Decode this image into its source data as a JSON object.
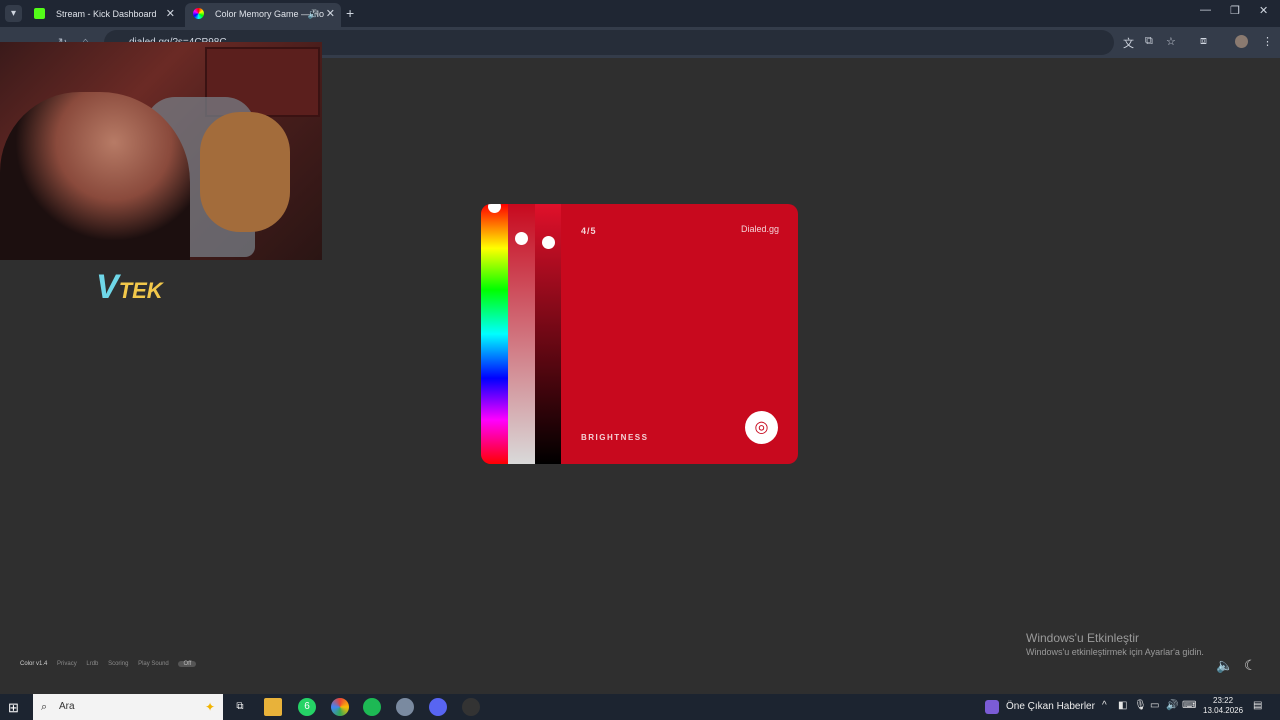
{
  "browser": {
    "tabs": [
      {
        "title": "Stream - Kick Dashboard",
        "favicon_color": "#53fc18"
      },
      {
        "title": "Color Memory Game — Ho",
        "favicon_color": "#e84393"
      }
    ],
    "url": "dialed.gg/?s=4CP98C"
  },
  "overlay": {
    "logo_v": "V",
    "logo_text": "TEK"
  },
  "game": {
    "round": "4/5",
    "brand": "Dialed.gg",
    "slider_label": "BRIGHTNESS",
    "color": "#c8091e"
  },
  "footer": {
    "version": "Color v1.4",
    "privacy": "Privacy",
    "link": "Lrdb",
    "scoring": "Scoring",
    "sound": "Play Sound",
    "sound_state": "Off"
  },
  "watermark": {
    "title": "Windows'u Etkinleştir",
    "subtitle": "Windows'u etkinleştirmek için Ayarlar'a gidin."
  },
  "taskbar": {
    "search_placeholder": "Ara",
    "whatsapp_badge": "6",
    "news": "Öne Çıkan Haberler",
    "time": "23:22",
    "date": "13.04.2026"
  }
}
